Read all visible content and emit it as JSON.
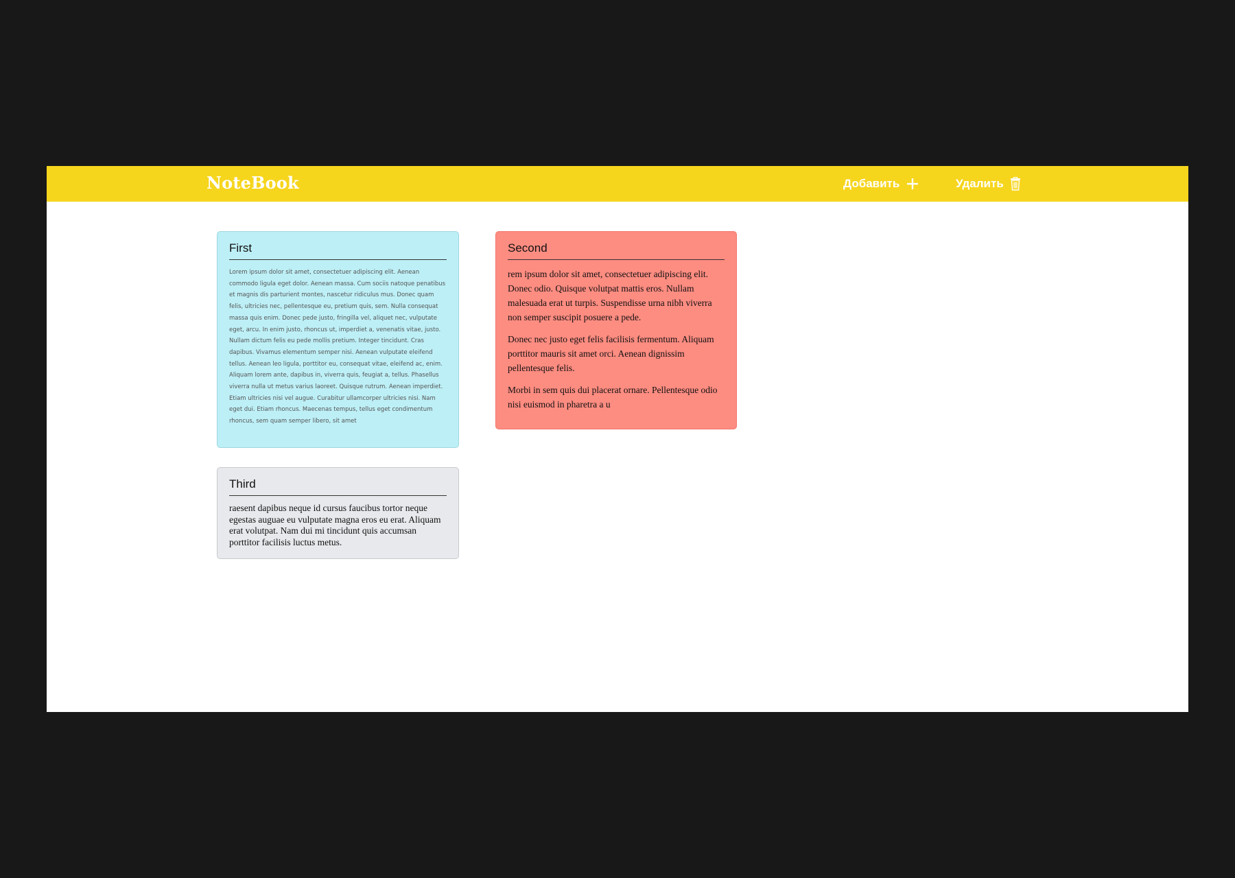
{
  "header": {
    "logo": "NoteBook",
    "add_label": "Добавить",
    "add_icon": "plus-icon",
    "delete_label": "Удалить",
    "delete_icon": "trash-icon"
  },
  "notes": [
    {
      "title": "First",
      "color": "#bdeff6",
      "body": "Lorem ipsum dolor sit amet, consectetuer adipiscing elit. Aenean commodo ligula eget dolor. Aenean massa. Cum sociis natoque penatibus et magnis dis parturient montes, nascetur ridiculus mus. Donec quam felis, ultricies nec, pellentesque eu, pretium quis, sem. Nulla consequat massa quis enim. Donec pede justo, fringilla vel, aliquet nec, vulputate eget, arcu. In enim justo, rhoncus ut, imperdiet a, venenatis vitae, justo. Nullam dictum felis eu pede mollis pretium. Integer tincidunt. Cras dapibus. Vivamus elementum semper nisi. Aenean vulputate eleifend tellus. Aenean leo ligula, porttitor eu, consequat vitae, eleifend ac, enim. Aliquam lorem ante, dapibus in, viverra quis, feugiat a, tellus. Phasellus viverra nulla ut metus varius laoreet. Quisque rutrum. Aenean imperdiet. Etiam ultricies nisi vel augue. Curabitur ullamcorper ultricies nisi. Nam eget dui. Etiam rhoncus. Maecenas tempus, tellus eget condimentum rhoncus, sem quam semper libero, sit amet"
    },
    {
      "title": "Second",
      "color": "#fd8c81",
      "paragraphs": [
        "rem ipsum dolor sit amet, consectetuer adipiscing elit. Donec odio. Quisque volutpat mattis eros. Nullam malesuada erat ut turpis. Suspendisse urna nibh viverra non semper suscipit posuere a pede.",
        "Donec nec justo eget felis facilisis fermentum. Aliquam porttitor mauris sit amet orci. Aenean dignissim pellentesque felis.",
        "Morbi in sem quis dui placerat ornare. Pellentesque odio nisi euismod in pharetra a u"
      ]
    },
    {
      "title": "Third",
      "color": "#e8e9ec",
      "body": "raesent dapibus neque id cursus faucibus tortor neque egestas auguae eu vulputate magna eros eu erat. Aliquam erat volutpat. Nam dui mi tincidunt quis accumsan porttitor facilisis luctus metus."
    }
  ]
}
